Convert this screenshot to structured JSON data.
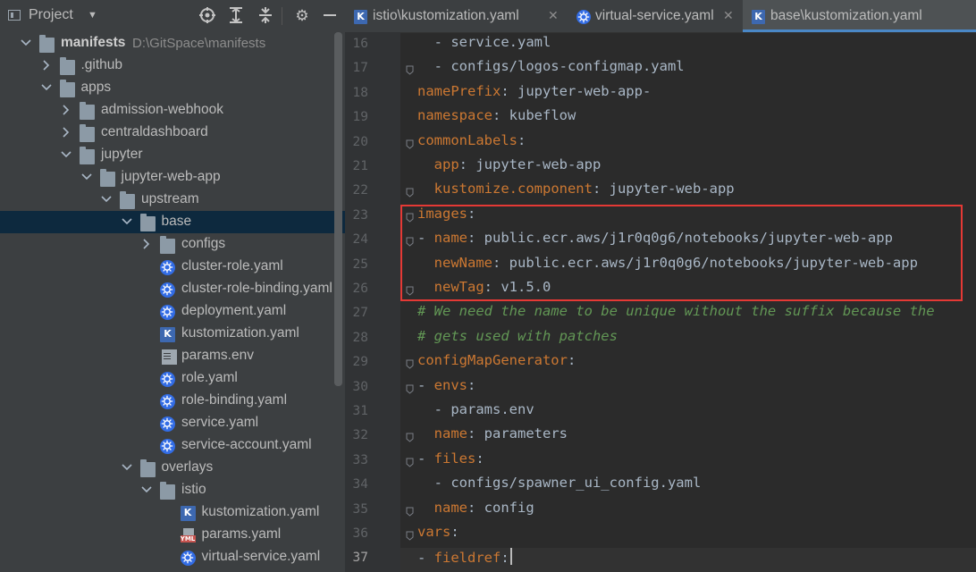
{
  "project_panel": {
    "title": "Project",
    "tree": [
      {
        "label": "manifests",
        "path": "D:\\GitSpace\\manifests",
        "type": "folder",
        "depth": 0,
        "expanded": true,
        "bold": true
      },
      {
        "label": ".github",
        "type": "folder",
        "depth": 1,
        "expanded": false
      },
      {
        "label": "apps",
        "type": "folder",
        "depth": 1,
        "expanded": true
      },
      {
        "label": "admission-webhook",
        "type": "folder",
        "depth": 2,
        "expanded": false
      },
      {
        "label": "centraldashboard",
        "type": "folder",
        "depth": 2,
        "expanded": false
      },
      {
        "label": "jupyter",
        "type": "folder",
        "depth": 2,
        "expanded": true
      },
      {
        "label": "jupyter-web-app",
        "type": "folder",
        "depth": 3,
        "expanded": true
      },
      {
        "label": "upstream",
        "type": "folder",
        "depth": 4,
        "expanded": true
      },
      {
        "label": "base",
        "type": "folder",
        "depth": 5,
        "expanded": true,
        "selected": true
      },
      {
        "label": "configs",
        "type": "folder",
        "depth": 6,
        "expanded": false
      },
      {
        "label": "cluster-role.yaml",
        "type": "k8s",
        "depth": 6
      },
      {
        "label": "cluster-role-binding.yaml",
        "type": "k8s",
        "depth": 6
      },
      {
        "label": "deployment.yaml",
        "type": "k8s",
        "depth": 6
      },
      {
        "label": "kustomization.yaml",
        "type": "kustomize",
        "depth": 6
      },
      {
        "label": "params.env",
        "type": "text",
        "depth": 6
      },
      {
        "label": "role.yaml",
        "type": "k8s",
        "depth": 6
      },
      {
        "label": "role-binding.yaml",
        "type": "k8s",
        "depth": 6
      },
      {
        "label": "service.yaml",
        "type": "k8s",
        "depth": 6
      },
      {
        "label": "service-account.yaml",
        "type": "k8s",
        "depth": 6
      },
      {
        "label": "overlays",
        "type": "folder",
        "depth": 5,
        "expanded": true
      },
      {
        "label": "istio",
        "type": "folder",
        "depth": 6,
        "expanded": true
      },
      {
        "label": "kustomization.yaml",
        "type": "kustomize",
        "depth": 7
      },
      {
        "label": "params.yaml",
        "type": "yml",
        "depth": 7
      },
      {
        "label": "virtual-service.yaml",
        "type": "k8s",
        "depth": 7
      }
    ]
  },
  "editor": {
    "tabs": [
      {
        "label": "istio\\kustomization.yaml",
        "icon": "kustomize",
        "active": false
      },
      {
        "label": "virtual-service.yaml",
        "icon": "k8s",
        "active": false
      },
      {
        "label": "base\\kustomization.yaml",
        "icon": "kustomize",
        "active": true
      }
    ],
    "current_line": 37,
    "lines": [
      {
        "n": 16,
        "fold": false,
        "parts": [
          {
            "t": "  - service.yaml",
            "c": "val"
          }
        ]
      },
      {
        "n": 17,
        "fold": true,
        "parts": [
          {
            "t": "  - configs/logos-configmap.yaml",
            "c": "val"
          }
        ]
      },
      {
        "n": 18,
        "fold": false,
        "parts": [
          {
            "t": "namePrefix",
            "c": "key"
          },
          {
            "t": ": jupyter-web-app-",
            "c": "val"
          }
        ]
      },
      {
        "n": 19,
        "fold": false,
        "parts": [
          {
            "t": "namespace",
            "c": "key"
          },
          {
            "t": ": kubeflow",
            "c": "val"
          }
        ]
      },
      {
        "n": 20,
        "fold": true,
        "parts": [
          {
            "t": "commonLabels",
            "c": "key"
          },
          {
            "t": ":",
            "c": "val"
          }
        ]
      },
      {
        "n": 21,
        "fold": false,
        "parts": [
          {
            "t": "  ",
            "c": "val"
          },
          {
            "t": "app",
            "c": "key"
          },
          {
            "t": ": jupyter-web-app",
            "c": "val"
          }
        ]
      },
      {
        "n": 22,
        "fold": true,
        "parts": [
          {
            "t": "  ",
            "c": "val"
          },
          {
            "t": "kustomize.component",
            "c": "key"
          },
          {
            "t": ": jupyter-web-app",
            "c": "val"
          }
        ]
      },
      {
        "n": 23,
        "fold": true,
        "parts": [
          {
            "t": "images",
            "c": "key"
          },
          {
            "t": ":",
            "c": "val"
          }
        ]
      },
      {
        "n": 24,
        "fold": true,
        "parts": [
          {
            "t": "- ",
            "c": "val"
          },
          {
            "t": "name",
            "c": "key"
          },
          {
            "t": ": public.ecr.aws/j1r0q0g6/notebooks/jupyter-web-app",
            "c": "val"
          }
        ]
      },
      {
        "n": 25,
        "fold": false,
        "parts": [
          {
            "t": "  ",
            "c": "val"
          },
          {
            "t": "newName",
            "c": "key"
          },
          {
            "t": ": public.ecr.aws/j1r0q0g6/notebooks/jupyter-web-app",
            "c": "val"
          }
        ]
      },
      {
        "n": 26,
        "fold": true,
        "parts": [
          {
            "t": "  ",
            "c": "val"
          },
          {
            "t": "newTag",
            "c": "key"
          },
          {
            "t": ": v1.5.0",
            "c": "val"
          }
        ]
      },
      {
        "n": 27,
        "fold": false,
        "parts": [
          {
            "t": "# We need the name to be unique without the suffix because the",
            "c": "com"
          }
        ]
      },
      {
        "n": 28,
        "fold": false,
        "parts": [
          {
            "t": "# gets used with patches",
            "c": "com"
          }
        ]
      },
      {
        "n": 29,
        "fold": true,
        "parts": [
          {
            "t": "configMapGenerator",
            "c": "key"
          },
          {
            "t": ":",
            "c": "val"
          }
        ]
      },
      {
        "n": 30,
        "fold": true,
        "parts": [
          {
            "t": "- ",
            "c": "val"
          },
          {
            "t": "envs",
            "c": "key"
          },
          {
            "t": ":",
            "c": "val"
          }
        ]
      },
      {
        "n": 31,
        "fold": false,
        "parts": [
          {
            "t": "  - params.env",
            "c": "val"
          }
        ]
      },
      {
        "n": 32,
        "fold": true,
        "parts": [
          {
            "t": "  ",
            "c": "val"
          },
          {
            "t": "name",
            "c": "key"
          },
          {
            "t": ": parameters",
            "c": "val"
          }
        ]
      },
      {
        "n": 33,
        "fold": true,
        "parts": [
          {
            "t": "- ",
            "c": "val"
          },
          {
            "t": "files",
            "c": "key"
          },
          {
            "t": ":",
            "c": "val"
          }
        ]
      },
      {
        "n": 34,
        "fold": false,
        "parts": [
          {
            "t": "  - configs/spawner_ui_config.yaml",
            "c": "val"
          }
        ]
      },
      {
        "n": 35,
        "fold": true,
        "parts": [
          {
            "t": "  ",
            "c": "val"
          },
          {
            "t": "name",
            "c": "key"
          },
          {
            "t": ": config",
            "c": "val"
          }
        ]
      },
      {
        "n": 36,
        "fold": true,
        "parts": [
          {
            "t": "vars",
            "c": "key"
          },
          {
            "t": ":",
            "c": "val"
          }
        ]
      },
      {
        "n": 37,
        "fold": true,
        "parts": [
          {
            "t": "- ",
            "c": "val"
          },
          {
            "t": "fieldref",
            "c": "key"
          },
          {
            "t": ":",
            "c": "val"
          }
        ]
      }
    ]
  },
  "colors": {
    "highlight_box": "#e53935",
    "key": "#cc7832",
    "comment": "#629755",
    "selection": "#0d293e"
  }
}
